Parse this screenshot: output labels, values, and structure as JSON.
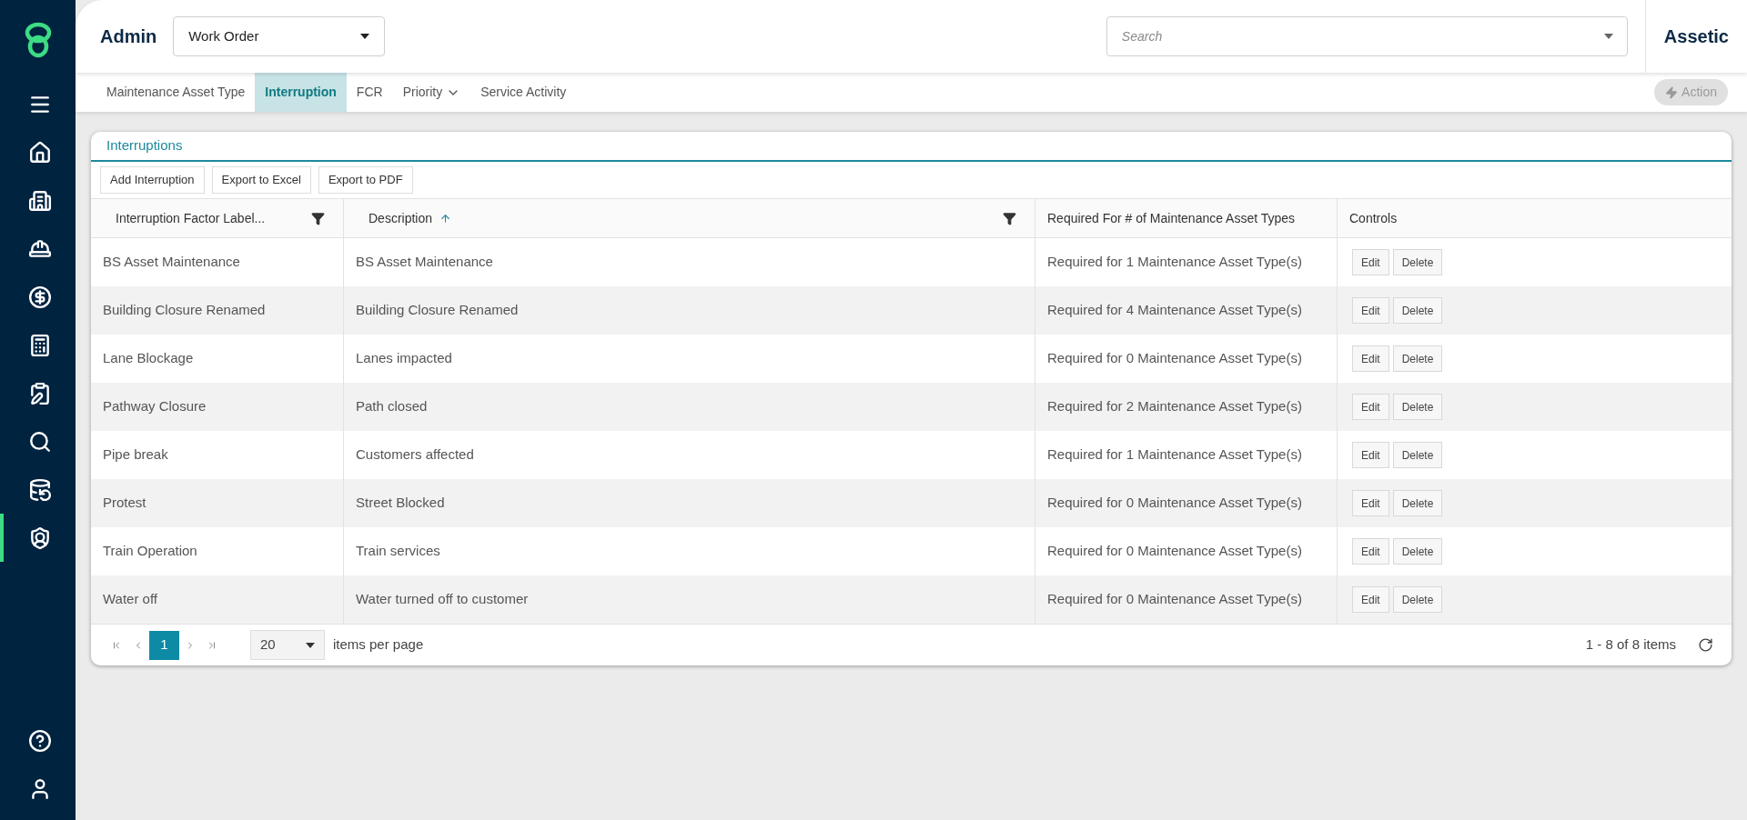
{
  "sidebar": {
    "items": [
      {
        "selected": false
      },
      {
        "selected": false
      },
      {
        "selected": false
      },
      {
        "selected": false
      },
      {
        "selected": false
      },
      {
        "selected": false
      },
      {
        "selected": false
      },
      {
        "selected": false
      },
      {
        "selected": false
      },
      {
        "selected": true
      }
    ]
  },
  "header": {
    "title": "Admin",
    "module_select": "Work Order",
    "search": {
      "placeholder": "Search"
    },
    "brand": "Assetic"
  },
  "tabs": [
    {
      "label": "Maintenance Asset Type",
      "selected": false,
      "has_menu": false
    },
    {
      "label": "Interruption",
      "selected": true,
      "has_menu": false
    },
    {
      "label": "FCR",
      "selected": false,
      "has_menu": false
    },
    {
      "label": "Priority",
      "selected": false,
      "has_menu": true
    },
    {
      "label": "Service Activity",
      "selected": false,
      "has_menu": false
    }
  ],
  "action_button": {
    "label": "Action",
    "disabled": true
  },
  "panel": {
    "title": "Interruptions",
    "toolbar": [
      "Add Interruption",
      "Export to Excel",
      "Export to PDF"
    ],
    "table": {
      "columns": [
        {
          "label": "Interruption Factor Label...",
          "filter": true,
          "sorted": false
        },
        {
          "label": "Description",
          "filter": true,
          "sorted": true
        },
        {
          "label": "Required For # of Maintenance Asset Types",
          "filter": false,
          "sorted": false
        },
        {
          "label": "Controls",
          "filter": false,
          "sorted": false
        }
      ],
      "rows": [
        {
          "label": "BS Asset Maintenance",
          "description": "BS Asset Maintenance",
          "required": "Required for 1 Maintenance Asset Type(s)",
          "controls": [
            "Edit",
            "Delete"
          ]
        },
        {
          "label": "Building Closure Renamed",
          "description": "Building Closure Renamed",
          "required": "Required for 4 Maintenance Asset Type(s)",
          "controls": [
            "Edit",
            "Delete"
          ]
        },
        {
          "label": "Lane Blockage",
          "description": "Lanes impacted",
          "required": "Required for 0 Maintenance Asset Type(s)",
          "controls": [
            "Edit",
            "Delete"
          ]
        },
        {
          "label": "Pathway Closure",
          "description": "Path closed",
          "required": "Required for 2 Maintenance Asset Type(s)",
          "controls": [
            "Edit",
            "Delete"
          ]
        },
        {
          "label": "Pipe break",
          "description": "Customers affected",
          "required": "Required for 1 Maintenance Asset Type(s)",
          "controls": [
            "Edit",
            "Delete"
          ]
        },
        {
          "label": "Protest",
          "description": "Street Blocked",
          "required": "Required for 0 Maintenance Asset Type(s)",
          "controls": [
            "Edit",
            "Delete"
          ]
        },
        {
          "label": "Train Operation",
          "description": "Train services",
          "required": "Required for 0 Maintenance Asset Type(s)",
          "controls": [
            "Edit",
            "Delete"
          ]
        },
        {
          "label": "Water off",
          "description": "Water turned off to customer",
          "required": "Required for 0 Maintenance Asset Type(s)",
          "controls": [
            "Edit",
            "Delete"
          ]
        }
      ]
    },
    "pager": {
      "pages": [
        {
          "label": "1",
          "selected": true
        }
      ],
      "page_size": "20",
      "page_size_label": "items per page",
      "summary": "1 - 8 of 8 items"
    }
  }
}
